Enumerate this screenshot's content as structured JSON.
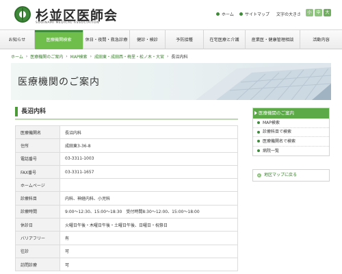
{
  "header": {
    "logo_title": "杉並区医師会",
    "logo_sub": "SUGINAMI MEDICAL ASSOCIATION",
    "links": {
      "home": "ホーム",
      "sitemap": "サイトマップ",
      "font_size": "文字の大きさ"
    },
    "font_buttons": [
      "小",
      "中",
      "大"
    ]
  },
  "nav": {
    "items": [
      {
        "label": "お知らせ",
        "active": false
      },
      {
        "label": "医療機関検索",
        "active": true
      },
      {
        "label": "休日・夜間・救急診療",
        "active": false
      },
      {
        "label": "健診・検診",
        "active": false
      },
      {
        "label": "予防接種",
        "active": false
      },
      {
        "label": "在宅医療と介護",
        "active": false
      },
      {
        "label": "産業医・健康管理相談",
        "active": false
      },
      {
        "label": "活動内容",
        "active": false
      }
    ]
  },
  "breadcrumb": [
    "ホーム",
    "医療機関のご案内",
    "MAP検索",
    "成田東・成田西・梅里・松ノ木・大宮",
    "長沼内科"
  ],
  "banner": {
    "title": "医療機関のご案内"
  },
  "section": {
    "title": "長沼内科"
  },
  "table": [
    {
      "key": "医療機関名",
      "value": "長沼内科"
    },
    {
      "key": "住所",
      "value": "成田東3-36-8"
    },
    {
      "key": "電話番号",
      "value": "03-3311-1003"
    },
    {
      "key": "FAX番号",
      "value": "03-3311-1657"
    },
    {
      "key": "ホームページ",
      "value": ""
    },
    {
      "key": "診療科目",
      "value": "内科、神経内科、小児科"
    },
    {
      "key": "診療時間",
      "value": "9:00～12:30、15:00～18:30　受付時間8:30～12:00、15:00～18:00"
    },
    {
      "key": "休診日",
      "value": "火曜日午後・木曜日午後・土曜日午後、日曜日・祝祭日"
    },
    {
      "key": "バリアフリー",
      "value": "有"
    },
    {
      "key": "往診",
      "value": "可"
    },
    {
      "key": "訪問診療",
      "value": "可"
    }
  ],
  "sidebar": {
    "title": "医療機関のご案内",
    "items": [
      "MAP検索",
      "診療科目で検索",
      "医療機関名で検索",
      "病院一覧"
    ],
    "map_link": "地区マップに戻る"
  },
  "colors": {
    "brand_green": "#3f8a3a",
    "nav_active": "#6fbe4c",
    "sidebar_head": "#5ca948"
  }
}
